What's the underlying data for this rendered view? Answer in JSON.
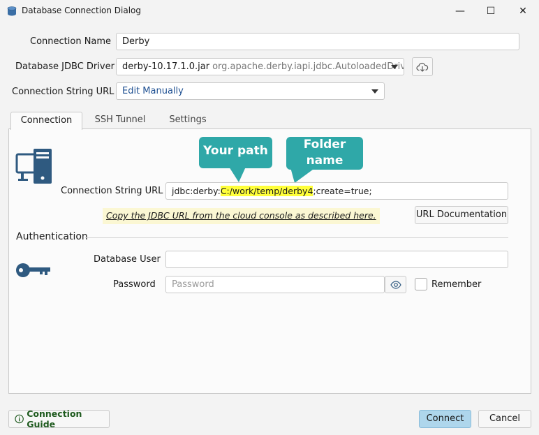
{
  "window": {
    "title": "Database Connection Dialog",
    "minimize": "—",
    "maximize": "☐",
    "close": "✕"
  },
  "form": {
    "connection_name_label": "Connection Name",
    "connection_name_value": "Derby",
    "driver_label": "Database JDBC Driver",
    "driver_jar": "derby-10.17.1.0.jar",
    "driver_class": "org.apache.derby.iapi.jdbc.AutoloadedDriver",
    "url_mode_label": "Connection String URL",
    "url_mode_value": "Edit Manually"
  },
  "tabs": [
    {
      "label": "Connection"
    },
    {
      "label": "SSH Tunnel"
    },
    {
      "label": "Settings"
    }
  ],
  "connection_tab": {
    "callouts": {
      "your_path": "Your path",
      "folder_name": "Folder name"
    },
    "url_label": "Connection String URL",
    "url_prefix": "jdbc:derby:",
    "url_path": "C:/work/temp/",
    "url_folder": "derby4",
    "url_suffix": ";create=true;",
    "copy_hint": "Copy the JDBC URL from the cloud console as described here.",
    "url_doc_button": "URL Documentation",
    "auth_section": "Authentication",
    "db_user_label": "Database User",
    "db_user_value": "",
    "password_label": "Password",
    "password_placeholder": "Password",
    "remember_label": "Remember"
  },
  "footer": {
    "guide_button": "Connection Guide",
    "connect_button": "Connect",
    "cancel_button": "Cancel"
  },
  "icons": {
    "app": "database-icon",
    "download": "cloud-download-icon",
    "computer": "computer-icon",
    "key": "key-icon",
    "eye": "eye-icon",
    "info": "info-icon"
  },
  "colors": {
    "callout": "#2fa8a8",
    "highlight": "#ffff3a",
    "primary_button": "#aed6ec",
    "guide_text": "#1e5a1e",
    "icon_blue": "#2f5a80"
  }
}
